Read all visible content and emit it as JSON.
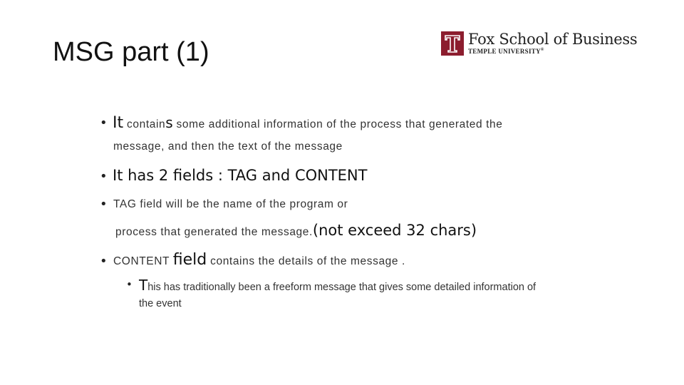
{
  "slide": {
    "title": "MSG part (1)",
    "logo": {
      "icon": "temple-t-icon",
      "brand_color": "#8c1d2e",
      "main": "Fox School of Business",
      "sub": "TEMPLE UNIVERSITY",
      "reg": "®"
    },
    "bullets": [
      {
        "lead": "It",
        "part1": " contain",
        "s": "s",
        "part2": " some additional information of the process that generated the",
        "line2": "message, and then the text of the message"
      },
      {
        "text": "It has 2 fields : TAG and CONTENT"
      },
      {
        "line1": "TAG field will be the name of the program  or",
        "line2": "process that generated the message.",
        "emph": "(not exceed 32 chars)"
      },
      {
        "part1": "CONTENT ",
        "emph": "field",
        "part2": " contains the details of the message .",
        "sub": {
          "lead": "T",
          "rest": "his has traditionally been a freeform message that gives some detailed information of",
          "line2": "the event"
        }
      }
    ]
  }
}
